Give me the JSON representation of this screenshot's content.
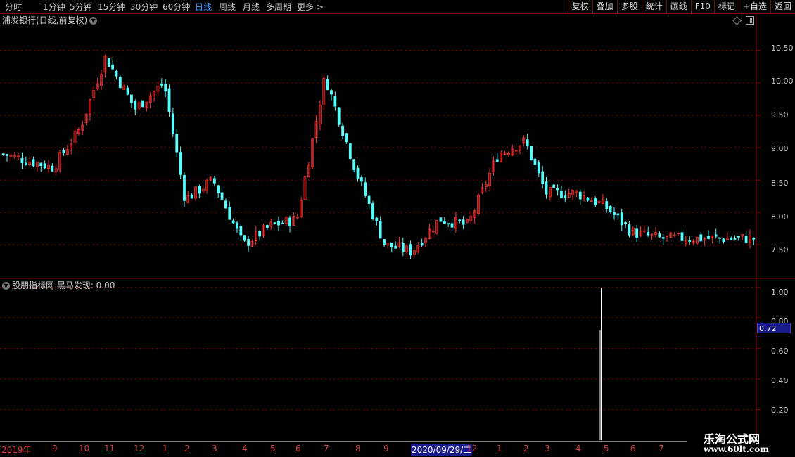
{
  "toolbar": {
    "periods": [
      "分时",
      "1分钟",
      "5分钟",
      "15分钟",
      "30分钟",
      "60分钟",
      "日线",
      "周线",
      "月线",
      "多周期",
      "更多 >"
    ],
    "active_period": "日线",
    "right_buttons": [
      "复权",
      "叠加",
      "多股",
      "统计",
      "画线",
      "F10",
      "标记",
      "+自选",
      "返回"
    ]
  },
  "main_panel": {
    "title": "浦发银行(日线,前复权)",
    "y_labels": [
      "10.50",
      "10.00",
      "9.50",
      "9.00",
      "8.50",
      "8.00",
      "7.50"
    ]
  },
  "indicator_panel": {
    "title": "股朋指标网 黑马发现: 0.00",
    "y_labels": [
      "1.00",
      "0.80",
      "0.60",
      "0.40",
      "0.20"
    ],
    "current_value": "0.72"
  },
  "x_axis": {
    "labels": [
      "2019年",
      "9",
      "10",
      "11",
      "12",
      "1",
      "2",
      "3",
      "4",
      "5",
      "6",
      "7",
      "8",
      "9",
      "2020/09/29/二",
      "12",
      "1",
      "2",
      "3",
      "4",
      "5",
      "6",
      "7"
    ],
    "selected_label": "2020/09/29/二"
  },
  "watermark": {
    "line1": "乐淘公式网",
    "line2": "www.60lt.com"
  },
  "colors": {
    "up": "#ff3232",
    "down": "#54ffff",
    "grid": "#8b0000",
    "active": "#2f8fff",
    "signal": "#ffffff"
  },
  "chart_data": {
    "type": "candlestick",
    "x_range": [
      "2019-08",
      "2021-07"
    ],
    "price_keypoints": [
      [
        "2019-08",
        8.9
      ],
      [
        "2019-09",
        8.7
      ],
      [
        "2019-10",
        9.3
      ],
      [
        "2019-11",
        10.4
      ],
      [
        "2019-12",
        9.6
      ],
      [
        "2020-01",
        10.0
      ],
      [
        "2020-02",
        8.2
      ],
      [
        "2020-03",
        8.5
      ],
      [
        "2020-04",
        7.5
      ],
      [
        "2020-05",
        7.8
      ],
      [
        "2020-06",
        7.9
      ],
      [
        "2020-07",
        10.1
      ],
      [
        "2020-08",
        8.6
      ],
      [
        "2020-09",
        7.5
      ],
      [
        "2020-10",
        7.4
      ],
      [
        "2020-11",
        7.9
      ],
      [
        "2020-12",
        7.8
      ],
      [
        "2021-01",
        8.9
      ],
      [
        "2021-02",
        9.1
      ],
      [
        "2021-03",
        8.3
      ],
      [
        "2021-04",
        8.3
      ],
      [
        "2021-05",
        8.1
      ],
      [
        "2021-06",
        7.7
      ],
      [
        "2021-07",
        7.6
      ]
    ],
    "price_ylim": [
      7.2,
      10.8
    ],
    "indicator": {
      "name": "黑马发现",
      "signal_date": "2021-05",
      "signal_value": 1.0,
      "ylim": [
        0,
        1.05
      ]
    }
  }
}
